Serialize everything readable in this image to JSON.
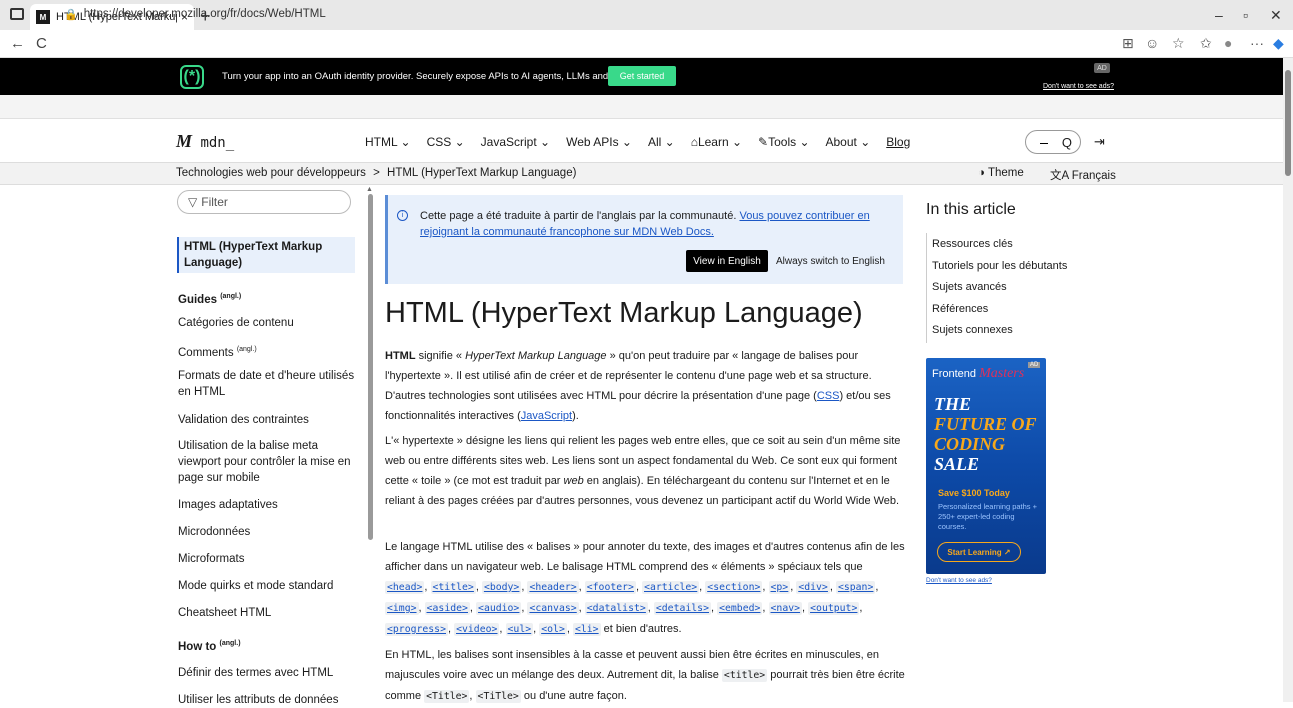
{
  "browser": {
    "tab_title": "HTML (HyperText Markup Langua",
    "tab_close": "×",
    "new_tab": "+",
    "url": "https://developer.mozilla.org/fr/docs/Web/HTML",
    "minimize": "–",
    "maximize": "▫",
    "close": "✕",
    "back": "←",
    "reload": "C",
    "favicon": "M",
    "toolbar_icons": [
      "⊞",
      "☺",
      "☆",
      "✩",
      "●",
      "···",
      "◆"
    ]
  },
  "ad_banner": {
    "logo": "(*)",
    "text": "Turn your app into an OAuth identity provider. Securely expose APIs to AI agents, LLMs and more.",
    "cta": "Get started",
    "badge": "AD",
    "no_ads": "Don't want to see ads?"
  },
  "header": {
    "logo_mark": "M",
    "logo_text": "mdn_",
    "nav": [
      "HTML ⌄",
      "CSS ⌄",
      "JavaScript ⌄",
      "Web APIs ⌄",
      "All ⌄",
      "Learn ⌄",
      "Tools ⌄",
      "About ⌄",
      "Blog"
    ],
    "search_icon": "Q",
    "login_icon": "⇥"
  },
  "breadcrumb": {
    "parent": "Technologies web pour développeurs",
    "separator": ">",
    "current": "HTML (HyperText Markup Language)",
    "theme": "Theme",
    "language": "Français"
  },
  "sidebar": {
    "filter_placeholder": "Filter",
    "active": "HTML (HyperText Markup Language)",
    "guides_heading": "Guides",
    "angl": "(angl.)",
    "items": [
      "Catégories de contenu",
      "Comments",
      "Formats de date et d'heure utilisés en HTML",
      "Validation des contraintes",
      "Utilisation de la balise meta viewport pour contrôler la mise en page sur mobile",
      "Images adaptatives",
      "Microdonnées",
      "Microformats",
      "Mode quirks et mode standard",
      "Cheatsheet HTML"
    ],
    "howto_heading": "How to",
    "howto_items": [
      "Définir des termes avec HTML",
      "Utiliser les attributs de données"
    ]
  },
  "notice": {
    "text": "Cette page a été traduite à partir de l'anglais par la communauté.",
    "link": "Vous pouvez contribuer en rejoignant la communauté francophone sur MDN Web Docs.",
    "view_english": "View in English",
    "always_english": "Always switch to English"
  },
  "article": {
    "title": "HTML (HyperText Markup Language)",
    "p1_strong": "HTML",
    "p1_a": " signifie « ",
    "p1_em": "HyperText Markup Language",
    "p1_b": " » qu'on peut traduire par « langage de balises pour l'hypertexte ». Il est utilisé afin de créer et de représenter le contenu d'une page web et sa structure. D'autres technologies sont utilisées avec HTML pour décrire la présentation d'une page (",
    "p1_css": "CSS",
    "p1_c": ") et/ou ses fonctionnalités interactives (",
    "p1_js": "JavaScript",
    "p1_d": ").",
    "p2_a": "L'« hypertexte » désigne les liens qui relient les pages web entre elles, que ce soit au sein d'un même site web ou entre différents sites web. Les liens sont un aspect fondamental du Web. Ce sont eux qui forment cette « toile » (ce mot est traduit par ",
    "p2_em": "web",
    "p2_b": " en anglais). En téléchargeant du contenu sur l'Internet et en le reliant à des pages créées par d'autres personnes, vous devenez un participant actif du World Wide Web.",
    "p3_a": "Le langage HTML utilise des « balises » pour annoter du texte, des images et d'autres contenus afin de les afficher dans un navigateur web. Le balisage HTML comprend des « éléments » spéciaux tels que ",
    "p3_tags": [
      "<head>",
      "<title>",
      "<body>",
      "<header>",
      "<footer>",
      "<article>",
      "<section>",
      "<p>",
      "<div>",
      "<span>",
      "<img>",
      "<aside>",
      "<audio>",
      "<canvas>",
      "<datalist>",
      "<details>",
      "<embed>",
      "<nav>",
      "<output>",
      "<progress>",
      "<video>",
      "<ul>",
      "<ol>",
      "<li>"
    ],
    "p3_b": " et bien d'autres.",
    "p4_a": "En HTML, les balises sont insensibles à la casse et peuvent aussi bien être écrites en minuscules, en majuscules voire avec un mélange des deux. Autrement dit, la balise ",
    "p4_code1": "<title>",
    "p4_b": " pourrait très bien être écrite comme ",
    "p4_code2": "<Title>",
    "p4_c": ", ",
    "p4_code3": "<TiTle>",
    "p4_d": " ou d'une autre façon."
  },
  "toc": {
    "title": "In this article",
    "items": [
      "Ressources clés",
      "Tutoriels pour les débutants",
      "Sujets avancés",
      "Références",
      "Sujets connexes"
    ]
  },
  "side_ad": {
    "brand_a": "Frontend ",
    "brand_b": "Masters",
    "badge": "AD",
    "line1": "THE ",
    "line1b": "FUTURE",
    "line1c": " OF",
    "line2": "CODING",
    "line2b": " SALE",
    "save": "Save $100 Today",
    "sub": "Personalized learning paths + 250+ expert-led coding courses.",
    "cta": "Start Learning ↗",
    "no_ads": "Don't want to see ads?"
  }
}
